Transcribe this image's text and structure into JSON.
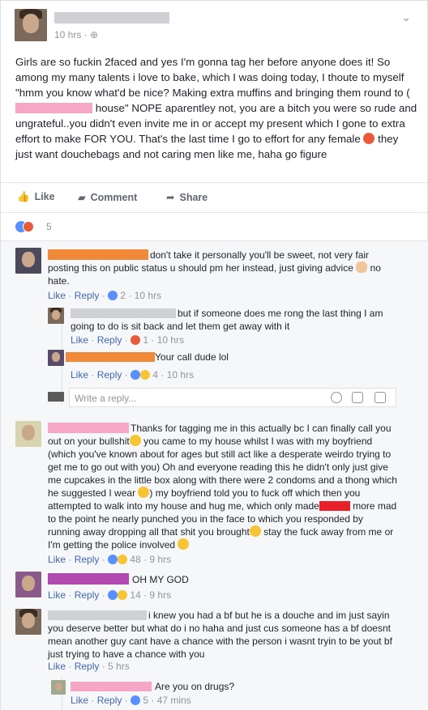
{
  "post": {
    "time": "10 hrs · ⊕",
    "text_1": "Girls are so fuckin 2faced and yes I'm gonna tag her before anyone does it! So among my many talents i love to bake, which I was doing today, I thoute to myself \"hmm you know what'd be nice? Making extra muffins and bringing them round to (",
    "text_2": " house\" NOPE aparentley not, you are a bitch you were so rude and ungrateful..you didn't even invite me in or accept my present which I gone to extra effort to make FOR YOU. That's the last time I go to effort for any female ",
    "text_3": " they just want douchebags and not caring men like me, haha go figure",
    "reaction_count": "5"
  },
  "actions": {
    "like": "Like",
    "comment": "Comment",
    "share": "Share"
  },
  "comments": [
    {
      "text_1": "don't take it personally you'll be sweet, not very fair posting this on public status u should pm her instead, just giving advice ",
      "text_2": " no hate.",
      "like": "Like",
      "reply": "Reply",
      "count": "2",
      "time": "10 hrs"
    },
    {
      "text": "but if someone does me rong the last thing I am going to do is sit back and let them get away with it",
      "like": "Like",
      "reply": "Reply",
      "count": "1",
      "time": "10 hrs"
    },
    {
      "text": "Your call dude lol",
      "like": "Like",
      "reply": "Reply",
      "count": "4",
      "time": "10 hrs"
    },
    {
      "text_1": "Thanks for tagging me in this actually bc I can finally call you out on your bullshit",
      "text_2": " you came to my house whilst I was with my boyfriend (which you've known about for ages but still act like a desperate weirdo trying to get me to go out with you) Oh and everyone reading this he didn't only just give me cupcakes in the little box along with there were 2 condoms and a thong which he suggested I wear ",
      "text_3": ") my boyfriend told you to fuck off which then you attempted to walk into my house and hug me, which only made",
      "text_4": " more mad to the point he nearly punched you in the face to which you responded by running away dropping all that shit you brought",
      "text_5": " stay the fuck away from me or I'm getting the police involved ",
      "like": "Like",
      "reply": "Reply",
      "count": "48",
      "time": "9 hrs"
    },
    {
      "text": "OH MY GOD",
      "like": "Like",
      "reply": "Reply",
      "count": "14",
      "time": "9 hrs"
    },
    {
      "text": "i knew you had a bf but he is a douche and im just sayin you deserve better but what do i no haha and just cus someone has a bf doesnt mean another guy cant have a chance with the person i wasnt tryin to be yout bf just trying to have a chance with you",
      "like": "Like",
      "reply": "Reply",
      "time": "5 hrs"
    },
    {
      "text": "Are you on drugs?",
      "like": "Like",
      "reply": "Reply",
      "count": "5",
      "time": "47 mins"
    }
  ],
  "reply_box": {
    "placeholder": "Write a reply..."
  },
  "colors": {
    "link": "#4267b2",
    "meta": "#90949c",
    "like_blue": "#5890ff",
    "angry": "#e65c3b"
  }
}
